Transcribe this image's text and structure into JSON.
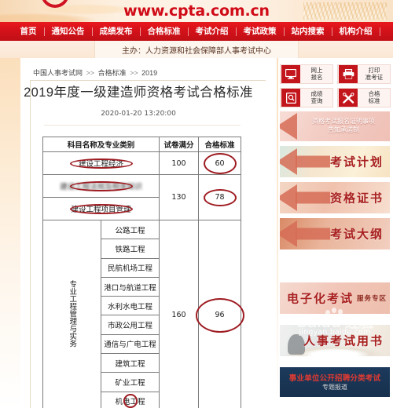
{
  "banner": {
    "url": "www.cpta.com.cn",
    "logo_icon": "red-arc-logo-icon"
  },
  "nav": {
    "items": [
      {
        "label": "首页"
      },
      {
        "label": "通知公告"
      },
      {
        "label": "成绩发布"
      },
      {
        "label": "合格标准"
      },
      {
        "label": "考试介绍"
      },
      {
        "label": "考试政策"
      },
      {
        "label": "站内搜索"
      },
      {
        "label": "机构介绍"
      }
    ]
  },
  "sponsor": {
    "text": "主办：人力资源和社会保障部人事考试中心"
  },
  "breadcrumb": {
    "site": "中国人事考试网",
    "sep": ">>",
    "section": "合格标准",
    "year": "2019"
  },
  "article": {
    "title": "2019年度一级建造师资格考试合格标准",
    "timestamp": "2020-01-20 13:20:00"
  },
  "table": {
    "headers": {
      "subject": "科目名称及专业类别",
      "full_score": "试卷满分",
      "pass_score": "合格标准"
    },
    "rows": [
      {
        "name": "建设工程经济",
        "full": "100",
        "pass": "60",
        "circled_name": true,
        "circled_pass": true,
        "blurred": false
      },
      {
        "name": "建设工程法规及相关知识",
        "full": "130",
        "pass": "78",
        "circled_name": true,
        "circled_pass": true,
        "blurred": true
      },
      {
        "name": "建设工程项目管理",
        "full": "",
        "pass": "",
        "circled_name": true,
        "circled_pass": false,
        "blurred": false
      }
    ],
    "group": {
      "vertical_label": "专业工程管理与实务",
      "full": "160",
      "pass": "96",
      "circled_pass": true,
      "items": [
        {
          "name": "公路工程",
          "circled": false
        },
        {
          "name": "铁路工程",
          "circled": false
        },
        {
          "name": "民航机场工程",
          "circled": false
        },
        {
          "name": "港口与航道工程",
          "circled": false
        },
        {
          "name": "水利水电工程",
          "circled": false
        },
        {
          "name": "市政公用工程",
          "circled": false
        },
        {
          "name": "通信与广电工程",
          "circled": false
        },
        {
          "name": "建筑工程",
          "circled": false
        },
        {
          "name": "矿业工程",
          "circled": false
        },
        {
          "name": "机电工程",
          "circled": true
        }
      ]
    }
  },
  "sidebar": {
    "quick_buttons": [
      {
        "label_line1": "网上",
        "label_line2": "报名",
        "icon": "monitor-icon"
      },
      {
        "label_line1": "打印",
        "label_line2": "准考证",
        "icon": "printer-icon"
      },
      {
        "label_line1": "成绩",
        "label_line2": "查询",
        "icon": "document-search-icon"
      },
      {
        "label_line1": "合格",
        "label_line2": "标准",
        "icon": "crossed-tools-icon"
      }
    ],
    "notice_banner": {
      "line1": "资格考试报名证明事项",
      "line2": "告知承诺制"
    },
    "banners": [
      {
        "title": "考试计划"
      },
      {
        "title": "资格证书"
      },
      {
        "title": "考试大纲"
      },
      {
        "title": "电子化考试",
        "suffix": "服务专区"
      },
      {
        "title": "人事考试用书"
      }
    ],
    "public_banner": {
      "title": "事业单位公开招聘分类考试",
      "subtitle": "专题报道"
    }
  },
  "watermark": {
    "word": "Baidu 经验",
    "url": "jingyan.baidu.com"
  }
}
